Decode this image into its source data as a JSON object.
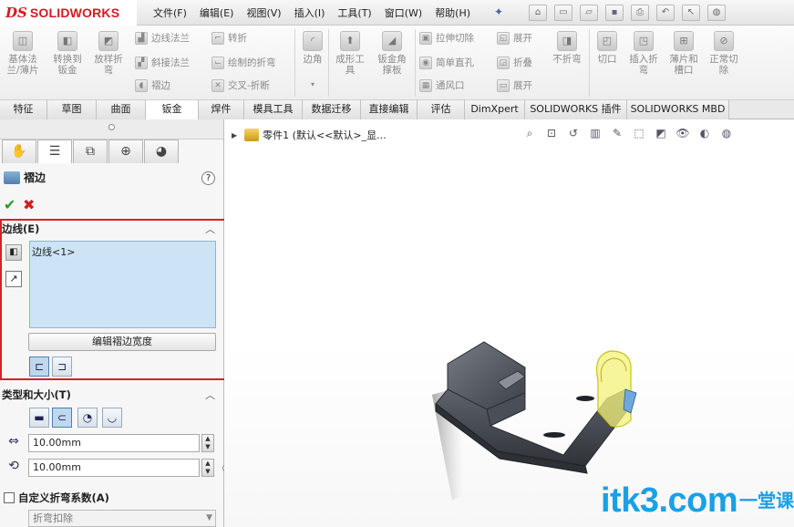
{
  "app": {
    "logo_prefix": "DS",
    "logo_name": "SOLIDWORKS"
  },
  "menu": [
    "文件(F)",
    "编辑(E)",
    "视图(V)",
    "插入(I)",
    "工具(T)",
    "窗口(W)",
    "帮助(H)"
  ],
  "ribbon": {
    "left_buttons": [
      {
        "label": "基体法\n兰/薄片",
        "icon": "base-flange-icon"
      },
      {
        "label": "转换到\n钣金",
        "icon": "convert-sheetmetal-icon"
      },
      {
        "label": "放样折\n弯",
        "icon": "lofted-bend-icon"
      }
    ],
    "col1": [
      "边线法兰",
      "斜接法兰",
      "褶边"
    ],
    "col2": [
      "转折",
      "绘制的折弯",
      "交叉-折断"
    ],
    "corner": "边角",
    "forming": [
      {
        "label": "成形工\n具",
        "icon": "forming-tool-icon"
      },
      {
        "label": "钣金角\n撑板",
        "icon": "gusset-icon"
      }
    ],
    "col3": [
      "拉伸切除",
      "简单直孔",
      "通风口"
    ],
    "col4": [
      "展开",
      "折叠",
      "展开"
    ],
    "right_buttons": [
      {
        "label": "不折弯",
        "icon": "no-bends-icon"
      },
      {
        "label": "切口",
        "icon": "rip-icon"
      },
      {
        "label": "插入折\n弯",
        "icon": "insert-bends-icon"
      },
      {
        "label": "薄片和\n槽口",
        "icon": "tab-slot-icon"
      },
      {
        "label": "正常切\n除",
        "icon": "normal-cut-icon"
      }
    ]
  },
  "tabs": [
    "特征",
    "草图",
    "曲面",
    "钣金",
    "焊件",
    "模具工具",
    "数据迁移",
    "直接编辑",
    "评估",
    "DimXpert",
    "SOLIDWORKS 插件",
    "SOLIDWORKS MBD"
  ],
  "active_tab": "钣金",
  "property_manager": {
    "title": "褶边",
    "help": "?",
    "edges_group": {
      "header": "边线(E)",
      "selection": "边线<1>",
      "edit_width_button": "编辑褶边宽度"
    },
    "type_size_group": {
      "header": "类型和大小(T)",
      "length": "10.00mm",
      "gap": "10.00mm"
    },
    "custom_bend": {
      "label": "自定义折弯系数(A)",
      "option": "折弯扣除"
    }
  },
  "viewport": {
    "tree_label": "零件1 (默认<<默认>_显..."
  },
  "watermark": {
    "text": "itk3.com",
    "cn": "一堂课"
  }
}
